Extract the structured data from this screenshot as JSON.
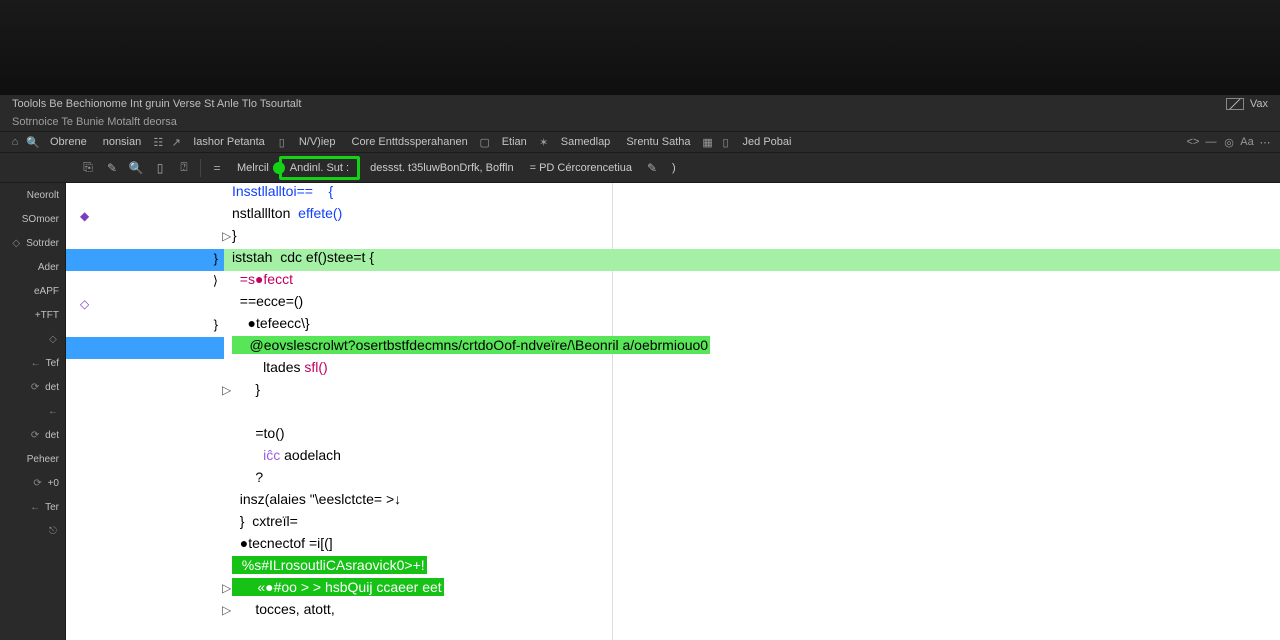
{
  "titlebar": {},
  "path": "Toolols Be Bechionome Int gruin Verse St Anle Tlo Tsourtalt",
  "subpath": "Sotrnoice Te Bunie Motalft deorsa",
  "menubar": {
    "items": [
      "Obrene",
      "nonsian",
      "",
      "Iashor Petanta",
      "",
      "N/V)iep",
      "Core Enttdssperahanen",
      "Etian",
      "",
      "Samedlap",
      "Srentu Satha",
      "",
      "Jed Pobai"
    ]
  },
  "right_icons": {
    "find_label": "Vax"
  },
  "toolbar": {
    "crumb_a": "Melrcil",
    "crumb_b": "Andinl. Sut    :",
    "crumb_c": "dessst. t35luwBonDrfk, Boffln",
    "crumb_d": "=  PD Cércorencetiua",
    "crumb_e": ")"
  },
  "sidebar": {
    "items": [
      {
        "label": "Neorolt"
      },
      {
        "label": "SOmoer"
      },
      {
        "label": "Sotrder",
        "icon": "◇"
      },
      {
        "label": "Ader"
      },
      {
        "label": "eAPF"
      },
      {
        "label": "+TFT"
      },
      {
        "label": "",
        "icon": "◇"
      },
      {
        "label": "Tef",
        "icon": "←"
      },
      {
        "label": "det",
        "icon": "⟳"
      },
      {
        "label": "",
        "icon": "←"
      },
      {
        "label": "det",
        "icon": "⟳"
      },
      {
        "label": "Peheer"
      },
      {
        "label": "+0",
        "icon": "⟳"
      },
      {
        "label": "Ter",
        "icon": "←"
      },
      {
        "label": "",
        "icon": "⎋"
      }
    ]
  },
  "code": {
    "l1": "Insstllalltoi==    {",
    "l2a": "nstlalllton  ",
    "l2b": "effete()",
    "l3": "}",
    "l4": "iststah  cdc ef()stee=t {",
    "l5": "  =s●fecct",
    "l6": "  ==ecce=()",
    "l7": "    ●tefeecc\\}",
    "l8": "    @eovslescrolwt?osertbstfdecmns/crtdoOof-ndveïre/\\Beonril a/oebrmiouo0",
    "l9a": "        ltades ",
    "l9b": "sfl()",
    "l10": "      }",
    "l11": "",
    "l12": "      =to()",
    "l13a": "        iĉc ",
    "l13b": "aodelach",
    "l14": "      ?",
    "l15": "  insz(alaies \"\\eeslctcte= >↓",
    "l16": "  }  cxtreïl=",
    "l17": "  ●tecnectof =i[(]",
    "l18": "  %s#ILrosoutliCAsraovіck0>+!",
    "l19a": "      «●#oo > > ",
    "l19b": "hsbQuij ccaeer eet",
    "l20": "      tocces, atott,"
  }
}
